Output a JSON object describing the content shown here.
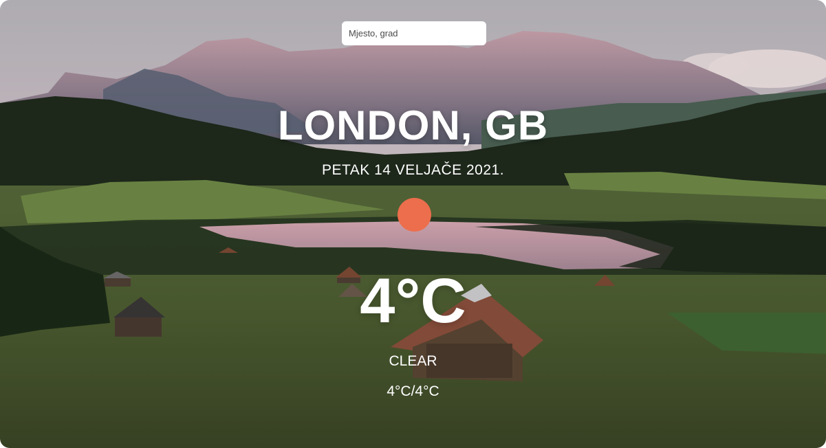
{
  "search": {
    "placeholder": "Mjesto, grad",
    "value": ""
  },
  "location": {
    "city": "LONDON, GB"
  },
  "date": "PETAK 14 VELJAČE 2021.",
  "weather": {
    "icon": "sun-icon",
    "icon_color": "#ec6e4c",
    "temperature": "4°C",
    "condition": "CLEAR",
    "min_max": "4°C/4°C"
  },
  "background": {
    "description": "mountain-lake-meadow-landscape"
  }
}
